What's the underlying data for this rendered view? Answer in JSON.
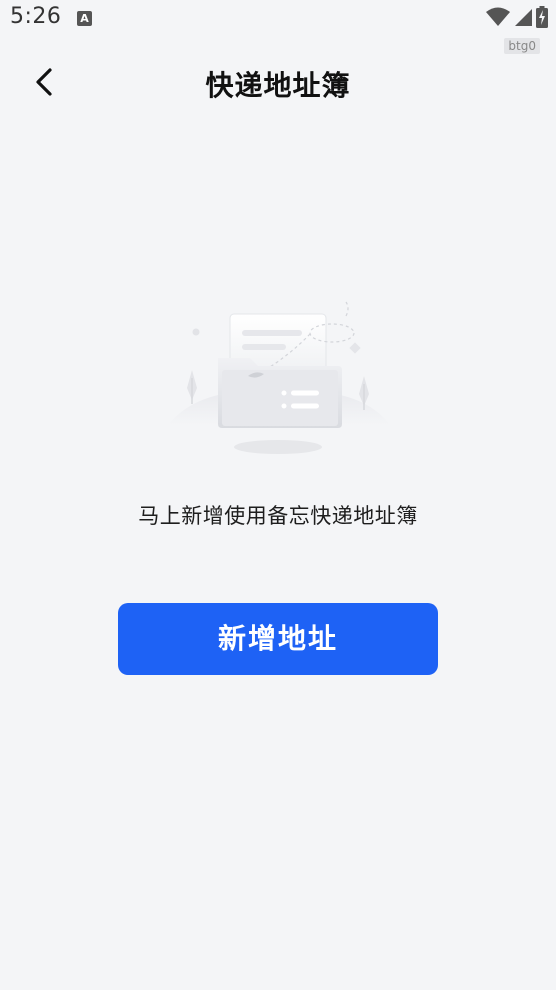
{
  "status_bar": {
    "time": "5:26",
    "notification_icon": "a-icon",
    "debug_badge": "btg0",
    "icons": [
      "wifi-icon",
      "signal-icon",
      "battery-charging-icon"
    ]
  },
  "nav": {
    "back_icon": "chevron-left-icon",
    "title": "快递地址簿"
  },
  "empty_state": {
    "illustration": "empty-folder-illustration",
    "message": "马上新增使用备忘快递地址簿"
  },
  "actions": {
    "add_address_label": "新增地址"
  },
  "colors": {
    "background": "#f4f5f7",
    "primary": "#1e62f5",
    "title_text": "#111111"
  }
}
